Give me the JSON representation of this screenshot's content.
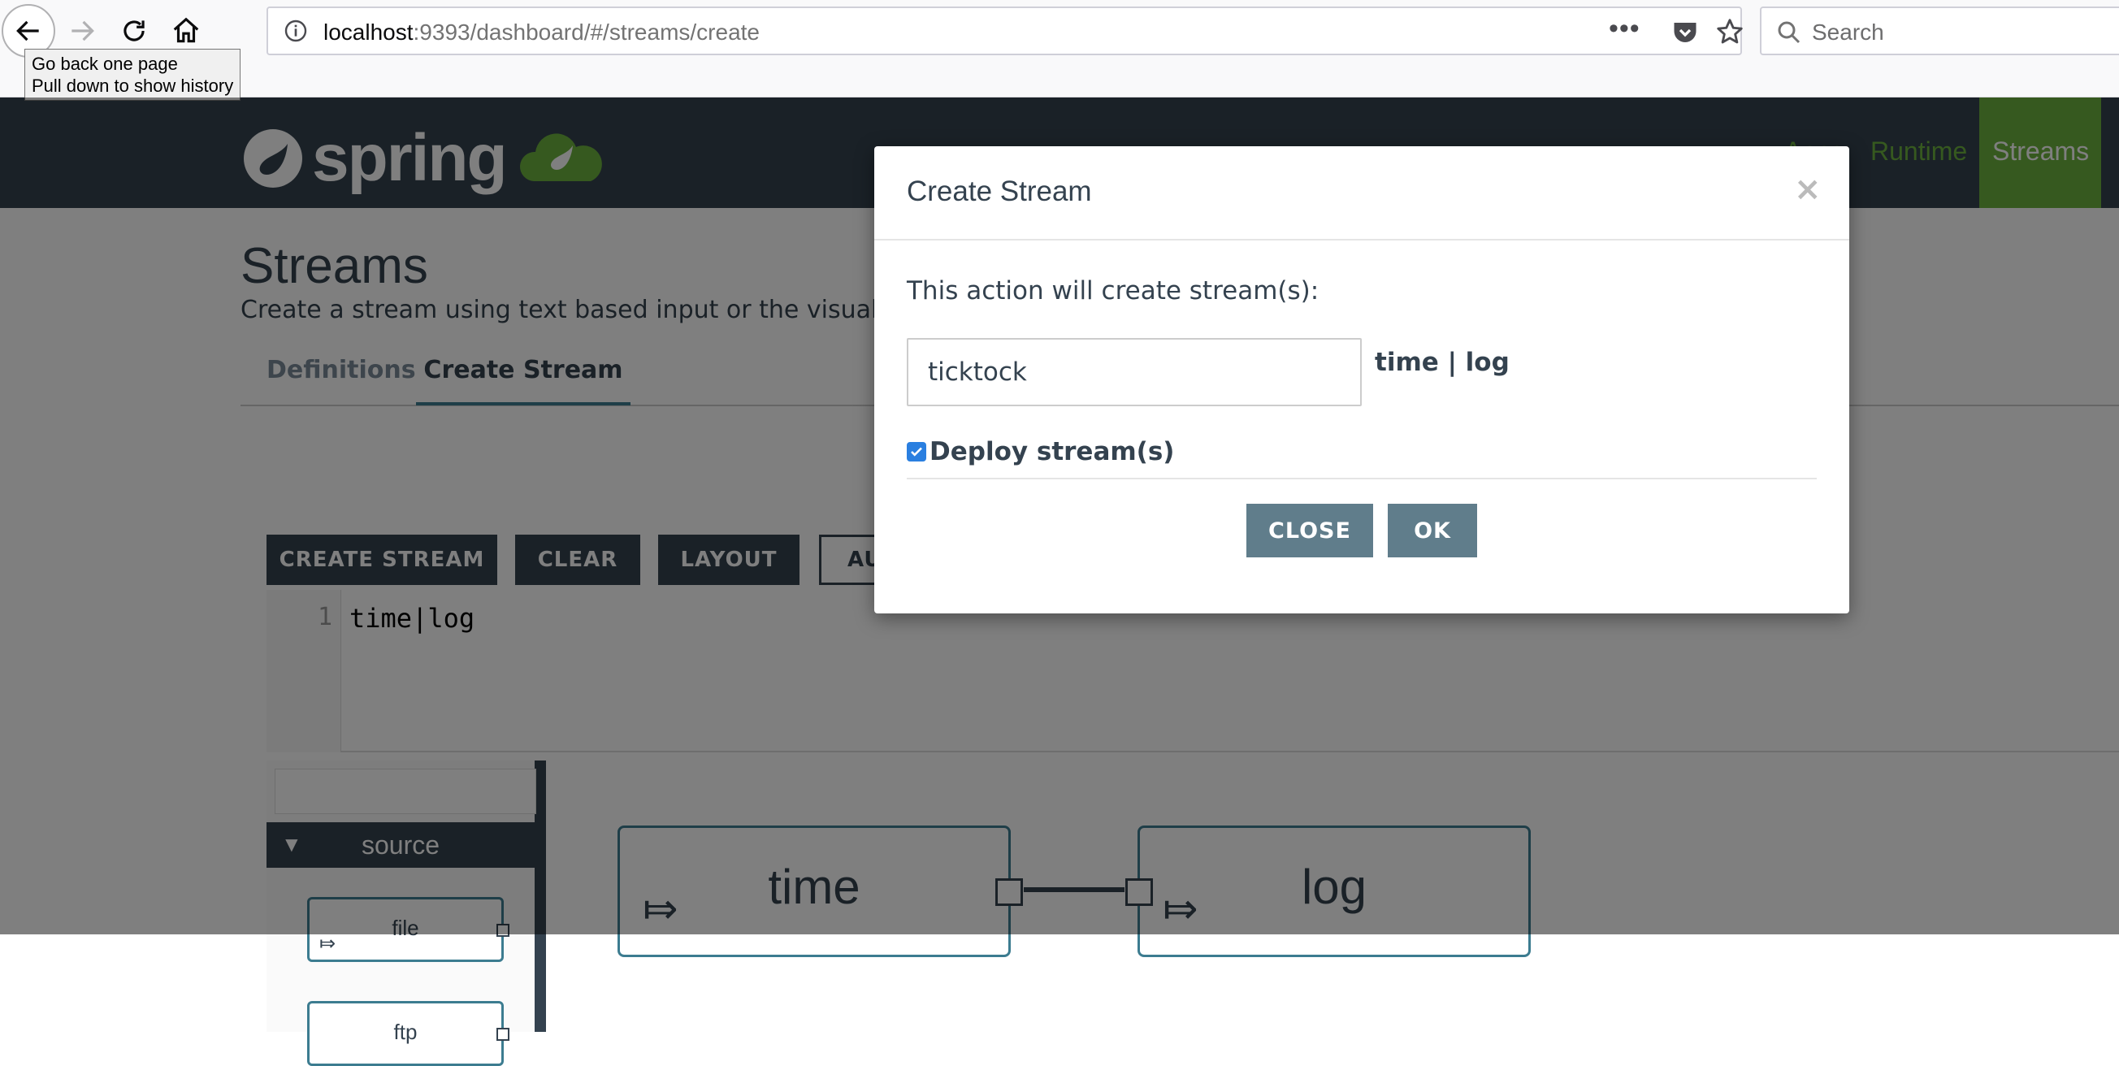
{
  "browser": {
    "url_host": "localhost",
    "url_rest": ":9393/dashboard/#/streams/create",
    "url_more": "•••",
    "search_placeholder": "Search",
    "tooltip_line1": "Go back one page",
    "tooltip_line2": "Pull down to show history"
  },
  "header": {
    "logo_text": "spring",
    "nav": {
      "apps": "Apps",
      "runtime": "Runtime",
      "streams": "Streams"
    }
  },
  "page": {
    "title": "Streams",
    "subtitle": "Create a stream using text based input or the visual editor.",
    "tabs": [
      {
        "label": "Definitions"
      },
      {
        "label": "Create Stream"
      }
    ],
    "toolbar": {
      "create": "CREATE STREAM",
      "clear": "CLEAR",
      "layout": "LAYOUT",
      "auto": "AU"
    },
    "editor": {
      "line_number": "1",
      "code": "time|log"
    },
    "palette": {
      "group": "source",
      "items": [
        "file",
        "ftp"
      ]
    },
    "canvas": {
      "nodes": [
        "time",
        "log"
      ]
    }
  },
  "modal": {
    "title": "Create Stream",
    "close_x": "×",
    "message": "This action will create stream(s):",
    "stream_name": "ticktock",
    "stream_definition": "time | log",
    "deploy_label": "Deploy stream(s)",
    "deploy_checked": true,
    "close_button": "CLOSE",
    "ok_button": "OK"
  },
  "colors": {
    "spring_green": "#6db33f",
    "header_bg": "#34424f",
    "node_border": "#3c7c90",
    "modal_button": "#607d8b"
  }
}
